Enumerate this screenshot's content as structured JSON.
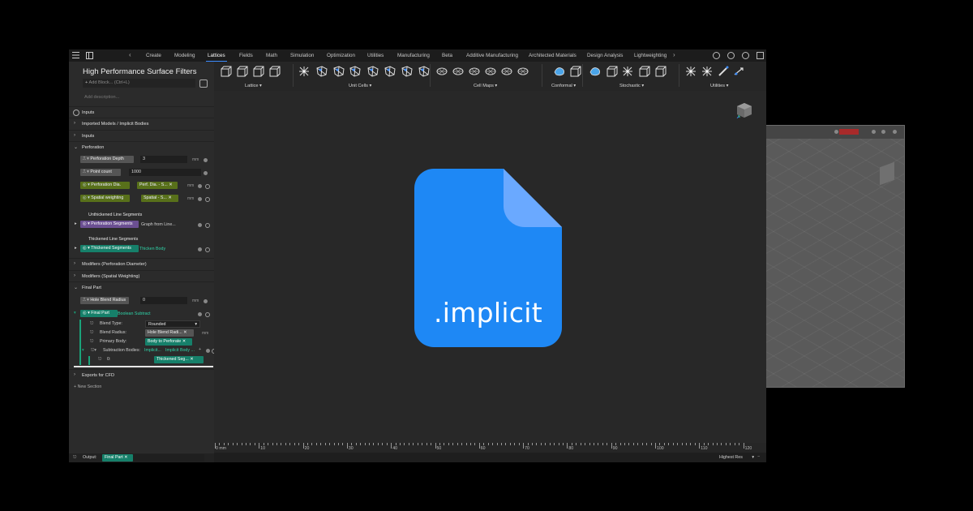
{
  "menu": {
    "tabs": [
      "Create",
      "Modeling",
      "Lattices",
      "Fields",
      "Math",
      "Simulation",
      "Optimization",
      "Utilities",
      "Manufacturing",
      "Beta",
      "Additive Manufacturing",
      "Architected Materials",
      "Design Analysis",
      "Lightweighting"
    ],
    "active_tab": "Lattices"
  },
  "sidebar": {
    "title": "High Performance Surface Filters",
    "add_block_placeholder": "Add Block... (Ctrl+L)",
    "add_description": "Add description...",
    "sections": {
      "inputs_top": "Inputs",
      "imported": "Imported Models / Implicit Bodies",
      "inputs": "Inputs",
      "perforation": "Perforation",
      "modifiers_perf": "Modifiers (Perforation Diameter)",
      "modifiers_spatial": "Modifiers (Spatial Weighting)",
      "final_part": "Final Part",
      "exports": "Exports for CFD"
    },
    "perforation_depth": {
      "label": "Perforation Depth",
      "value": "3",
      "unit": "mm"
    },
    "point_count": {
      "label": "Point count",
      "value": "1000"
    },
    "perforation_dia": {
      "label": "Perforation Dia.",
      "value": "Perf. Dia. - S...",
      "unit": "mm"
    },
    "spatial_weighting": {
      "label": "Spatial weighting",
      "value": "Spatial - S...",
      "unit": "mm"
    },
    "unthickened_heading": "Unthickened Line Segments",
    "perforation_segments": {
      "label": "Perforation Segments",
      "value": "Graph from Line..."
    },
    "thickened_heading": "Thickened Line Segments",
    "thickened_segments": {
      "label": "Thickened Segments",
      "value": "Thicken Body"
    },
    "hole_blend_radius": {
      "label": "Hole Blend Radius",
      "value": "0",
      "unit": "mm"
    },
    "final_part_block": {
      "label": "Final Part",
      "op": "Boolean Subtract"
    },
    "blend_type": {
      "label": "Blend Type:",
      "value": "Rounded"
    },
    "blend_radius": {
      "label": "Blend Radius:",
      "value": "Hole Blend Radi...",
      "unit": "mm"
    },
    "primary_body": {
      "label": "Primary Body:",
      "value": "Body to Perforate"
    },
    "subtraction_bodies": {
      "label": "Subtraction Bodies:",
      "type": "Implicit...",
      "value": "Implicit Body ..."
    },
    "sub_item": {
      "index": "0:",
      "value": "Thickened Seg..."
    },
    "new_section": "New Section",
    "output": {
      "label": "Output:",
      "value": "Final Part"
    }
  },
  "toolbar": {
    "groups": [
      "Lattice",
      "Unit Cells",
      "Cell Maps",
      "Conformal",
      "Stochastic",
      "Utilities"
    ]
  },
  "ruler": {
    "unit_label": "0 mm",
    "ticks": [
      "10",
      "20",
      "30",
      "40",
      "50",
      "60",
      "70",
      "80",
      "90",
      "100",
      "110",
      "120"
    ]
  },
  "status": {
    "resolution": "Highest Res"
  },
  "overlay": {
    "file_extension": ".implicit"
  },
  "colors": {
    "accent": "#3b8cff",
    "file_blue": "#1e88f5",
    "file_fold": "#6aa9ff",
    "teal": "#2fd3a8"
  }
}
